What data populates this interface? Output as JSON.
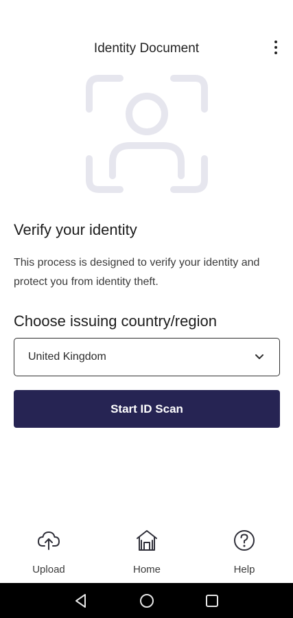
{
  "header": {
    "title": "Identity Document",
    "more_icon": "more-vert-icon"
  },
  "hero": {
    "icon": "face-scan-icon",
    "color": "#e6e6ee"
  },
  "verify": {
    "title": "Verify your identity",
    "description": "This process is designed to verify your identity and protect you from identity theft."
  },
  "country": {
    "label": "Choose issuing country/region",
    "selected": "United Kingdom"
  },
  "start_button": {
    "label": "Start ID Scan",
    "color": "#262453"
  },
  "bottom_nav": {
    "items": [
      {
        "label": "Upload",
        "icon": "cloud-upload-icon"
      },
      {
        "label": "Home",
        "icon": "home-icon"
      },
      {
        "label": "Help",
        "icon": "help-circle-icon"
      }
    ]
  },
  "system_nav": {
    "buttons": [
      "back-icon",
      "home-circle-icon",
      "recents-icon"
    ]
  }
}
